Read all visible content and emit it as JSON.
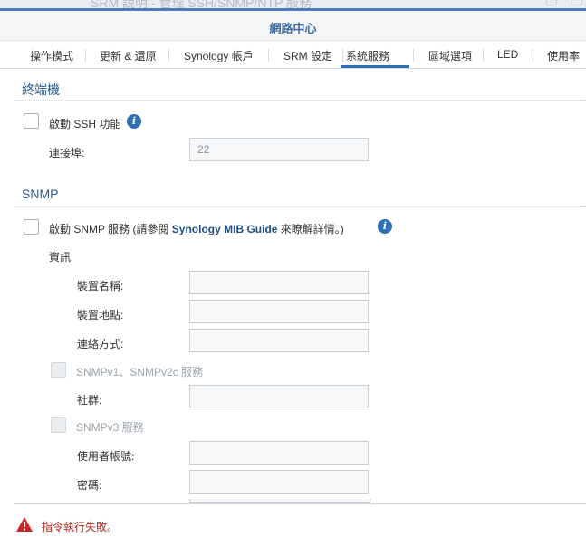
{
  "background_title": "SRM 說明 - 管理 SSH/SNMP/NTP 服務",
  "window": {
    "title": "網路中心",
    "tabs": [
      {
        "label": "操作模式"
      },
      {
        "label": "更新 & 還原"
      },
      {
        "label": "Synology 帳戶"
      },
      {
        "label": "SRM 設定"
      },
      {
        "label": "系統服務",
        "active": true
      },
      {
        "label": "區域選項"
      },
      {
        "label": "LED"
      },
      {
        "label": "使用率"
      }
    ]
  },
  "terminal": {
    "section_title": "終端機",
    "ssh_label": "啟動 SSH 功能",
    "ssh_enabled": false,
    "port_label": "連接埠:",
    "port_value": "22"
  },
  "snmp": {
    "section_title": "SNMP",
    "enable_prefix": "啟動 SNMP 服務 (請參閱 ",
    "enable_link": "Synology MIB Guide",
    "enable_suffix": " 來瞭解詳情。)",
    "snmp_enabled": false,
    "info_header": "資訊",
    "device_name_label": "裝置名稱:",
    "device_location_label": "裝置地點:",
    "contact_label": "連絡方式:",
    "v1v2_label": "SNMPv1、SNMPv2c 服務",
    "community_label": "社群:",
    "v3_label": "SNMPv3 服務",
    "username_label": "使用者帳號:",
    "password_label": "密碼:"
  },
  "status": {
    "error_message": "指令執行失敗。"
  },
  "colors": {
    "accent": "#2f6fb3",
    "section_title": "#2b5a8c",
    "error": "#b3261e",
    "header_title": "#3e6ea3"
  }
}
